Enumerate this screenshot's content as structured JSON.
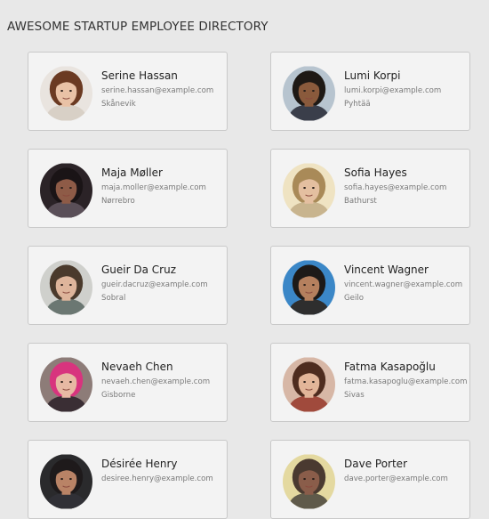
{
  "header": {
    "title": "AWESOME STARTUP EMPLOYEE DIRECTORY"
  },
  "employees": [
    {
      "name": "Serine Hassan",
      "email": "serine.hassan@example.com",
      "city": "Skånevik",
      "photo": {
        "bg": "#e9e4df",
        "hair": "#6b3a22",
        "skin": "#e9c2a6",
        "shirt": "#d8d0c6"
      }
    },
    {
      "name": "Lumi Korpi",
      "email": "lumi.korpi@example.com",
      "city": "Pyhtää",
      "photo": {
        "bg": "#b7c4cf",
        "hair": "#1e1915",
        "skin": "#8a5a3c",
        "shirt": "#3a3e4a"
      }
    },
    {
      "name": "Maja Møller",
      "email": "maja.moller@example.com",
      "city": "Nørrebro",
      "photo": {
        "bg": "#2b2327",
        "hair": "#1a1416",
        "skin": "#8e5b47",
        "shirt": "#5a4f58"
      }
    },
    {
      "name": "Sofia Hayes",
      "email": "sofia.hayes@example.com",
      "city": "Bathurst",
      "photo": {
        "bg": "#efe3c2",
        "hair": "#a98a58",
        "skin": "#e4bfa0",
        "shirt": "#c8b48e"
      }
    },
    {
      "name": "Gueir Da Cruz",
      "email": "gueir.dacruz@example.com",
      "city": "Sobral",
      "photo": {
        "bg": "#cfd0cc",
        "hair": "#4a3a2c",
        "skin": "#deb59b",
        "shirt": "#6b7772"
      }
    },
    {
      "name": "Vincent Wagner",
      "email": "vincent.wagner@example.com",
      "city": "Geilo",
      "photo": {
        "bg": "#3b87c7",
        "hair": "#1d1a18",
        "skin": "#b5805e",
        "shirt": "#2e2e2e"
      }
    },
    {
      "name": "Nevaeh Chen",
      "email": "nevaeh.chen@example.com",
      "city": "Gisborne",
      "photo": {
        "bg": "#8d7c78",
        "hair": "#d8347e",
        "skin": "#e7b9a3",
        "shirt": "#3a2e34"
      }
    },
    {
      "name": "Fatma Kasapoğlu",
      "email": "fatma.kasapoglu@example.com",
      "city": "Sivas",
      "photo": {
        "bg": "#d7b7a6",
        "hair": "#4e2c1f",
        "skin": "#e2b599",
        "shirt": "#a04a3c"
      }
    },
    {
      "name": "Désirée Henry",
      "email": "desiree.henry@example.com",
      "city": "",
      "photo": {
        "bg": "#2a2a2c",
        "hair": "#1e1a1b",
        "skin": "#b98366",
        "shirt": "#303036"
      }
    },
    {
      "name": "Dave Porter",
      "email": "dave.porter@example.com",
      "city": "",
      "photo": {
        "bg": "#e4d9a0",
        "hair": "#4a3a30",
        "skin": "#8a5d4a",
        "shirt": "#5f5a4a"
      }
    }
  ]
}
